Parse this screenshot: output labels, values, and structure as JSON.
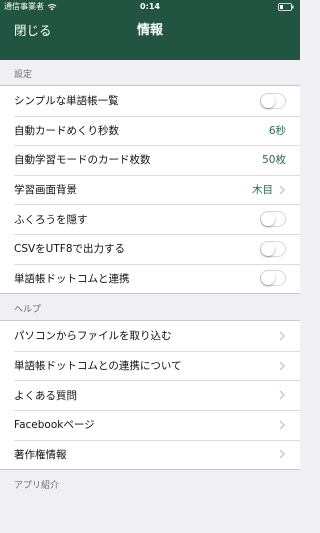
{
  "status_bar": {
    "carrier": "通信事業者",
    "time": "0:14"
  },
  "nav": {
    "close_label": "閉じる",
    "title": "情報"
  },
  "sections": {
    "settings": {
      "header": "設定",
      "items": [
        {
          "label": "シンプルな単語帳一覧",
          "type": "toggle",
          "on": false
        },
        {
          "label": "自動カードめくり秒数",
          "type": "value",
          "value": "6秒"
        },
        {
          "label": "自動学習モードのカード枚数",
          "type": "value",
          "value": "50枚"
        },
        {
          "label": "学習画面背景",
          "type": "value-chevron",
          "value": "木目",
          "icon": "chevron-right-icon"
        },
        {
          "label": "ふくろうを隠す",
          "type": "toggle",
          "on": false
        },
        {
          "label": "CSVをUTF8で出力する",
          "type": "toggle",
          "on": false
        },
        {
          "label": "単語帳ドットコムと連携",
          "type": "toggle",
          "on": false
        }
      ]
    },
    "help": {
      "header": "ヘルプ",
      "items": [
        {
          "label": "パソコンからファイルを取り込む",
          "icon": "chevron-right-icon"
        },
        {
          "label": "単語帳ドットコムとの連携について",
          "icon": "chevron-right-icon"
        },
        {
          "label": "よくある質問",
          "icon": "chevron-right-icon"
        },
        {
          "label": "Facebookページ",
          "icon": "chevron-right-icon"
        },
        {
          "label": "著作権情報",
          "icon": "chevron-right-icon"
        }
      ]
    },
    "apps": {
      "header": "アプリ紹介"
    }
  },
  "colors": {
    "header_bg": "#225541",
    "accent": "#2c6b49",
    "page_bg": "#efeff4"
  }
}
